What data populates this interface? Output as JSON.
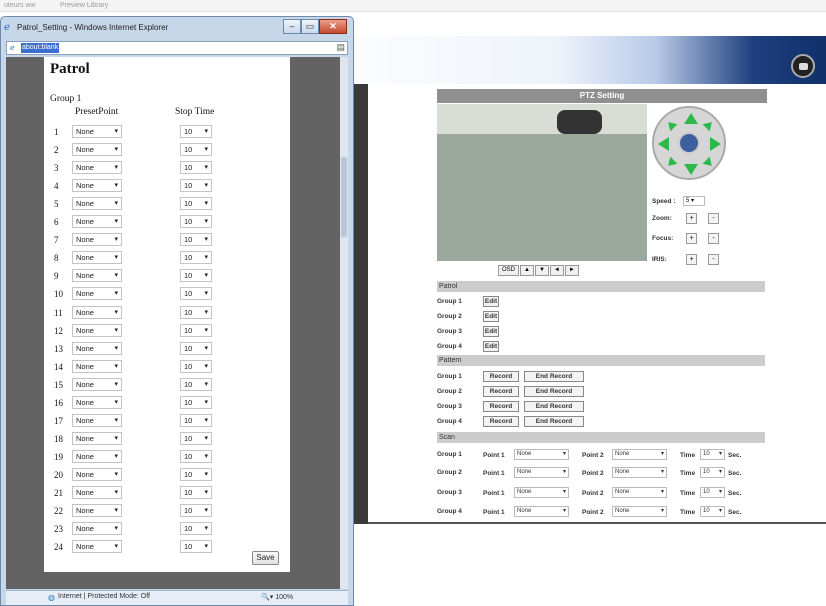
{
  "top_strip": {
    "left": "uteurs ww",
    "right": "Preview Library"
  },
  "ie": {
    "title": "Patrol_Setting - Windows Internet Explorer",
    "minimize": "–",
    "maximize": "▭",
    "close": "✕",
    "address": "about:blank",
    "status_zone": "Internet | Protected Mode: Off",
    "status_zoom": "100%",
    "status_zoom_icon": "🔍▾"
  },
  "patrol_page": {
    "title": "Patrol",
    "group": "Group 1",
    "col_preset": "PresetPoint",
    "col_stop": "Stop Time",
    "rows": [
      {
        "n": "1",
        "preset": "None",
        "stop": "10"
      },
      {
        "n": "2",
        "preset": "None",
        "stop": "10"
      },
      {
        "n": "3",
        "preset": "None",
        "stop": "10"
      },
      {
        "n": "4",
        "preset": "None",
        "stop": "10"
      },
      {
        "n": "5",
        "preset": "None",
        "stop": "10"
      },
      {
        "n": "6",
        "preset": "None",
        "stop": "10"
      },
      {
        "n": "7",
        "preset": "None",
        "stop": "10"
      },
      {
        "n": "8",
        "preset": "None",
        "stop": "10"
      },
      {
        "n": "9",
        "preset": "None",
        "stop": "10"
      },
      {
        "n": "10",
        "preset": "None",
        "stop": "10"
      },
      {
        "n": "11",
        "preset": "None",
        "stop": "10"
      },
      {
        "n": "12",
        "preset": "None",
        "stop": "10"
      },
      {
        "n": "13",
        "preset": "None",
        "stop": "10"
      },
      {
        "n": "14",
        "preset": "None",
        "stop": "10"
      },
      {
        "n": "15",
        "preset": "None",
        "stop": "10"
      },
      {
        "n": "16",
        "preset": "None",
        "stop": "10"
      },
      {
        "n": "17",
        "preset": "None",
        "stop": "10"
      },
      {
        "n": "18",
        "preset": "None",
        "stop": "10"
      },
      {
        "n": "19",
        "preset": "None",
        "stop": "10"
      },
      {
        "n": "20",
        "preset": "None",
        "stop": "10"
      },
      {
        "n": "21",
        "preset": "None",
        "stop": "10"
      },
      {
        "n": "22",
        "preset": "None",
        "stop": "10"
      },
      {
        "n": "23",
        "preset": "None",
        "stop": "10"
      },
      {
        "n": "24",
        "preset": "None",
        "stop": "10"
      }
    ],
    "save": "Save"
  },
  "ptz": {
    "title": "PTZ Setting",
    "speed_label": "Speed :",
    "speed_value": "5",
    "zoom_label": "Zoom:",
    "focus_label": "Focus:",
    "iris_label": "IRIS:",
    "plus": "+",
    "minus": "-",
    "osd": "OSD",
    "up": "▲",
    "down": "▼",
    "left": "◄",
    "right": "►"
  },
  "patrol": {
    "header": "Patrol",
    "edit": "Edit",
    "groups": [
      "Group 1",
      "Group 2",
      "Group 3",
      "Group 4"
    ]
  },
  "pattern": {
    "header": "Pattern",
    "record": "Record",
    "end_record": "End Record",
    "groups": [
      "Group 1",
      "Group 2",
      "Group 3",
      "Group 4"
    ]
  },
  "scan": {
    "header": "Scan",
    "point1": "Point 1",
    "point2": "Point 2",
    "none": "None",
    "time": "Time",
    "time_value": "10",
    "sec": "Sec.",
    "groups": [
      "Group 1",
      "Group 2",
      "Group 3",
      "Group 4"
    ]
  }
}
